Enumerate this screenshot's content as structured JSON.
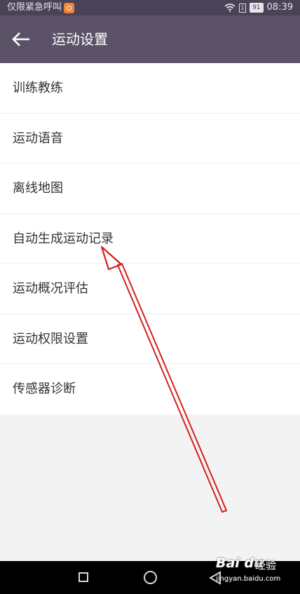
{
  "status_bar": {
    "emergency_text": "仅限紧急呼叫",
    "sim_label": "1",
    "battery": "91",
    "time": "08:39"
  },
  "header": {
    "title": "运动设置"
  },
  "settings": {
    "items": [
      {
        "label": "训练教练"
      },
      {
        "label": "运动语音"
      },
      {
        "label": "离线地图"
      },
      {
        "label": "自动生成运动记录"
      },
      {
        "label": "运动概况评估"
      },
      {
        "label": "运动权限设置"
      },
      {
        "label": "传感器诊断"
      }
    ]
  },
  "watermark": {
    "logo": "Bai du",
    "text": "经验",
    "url": "jingyan.baidu.com"
  },
  "colors": {
    "status_bar": "#4a4256",
    "title_bar": "#5b5267",
    "annotation_arrow": "#d42020"
  }
}
